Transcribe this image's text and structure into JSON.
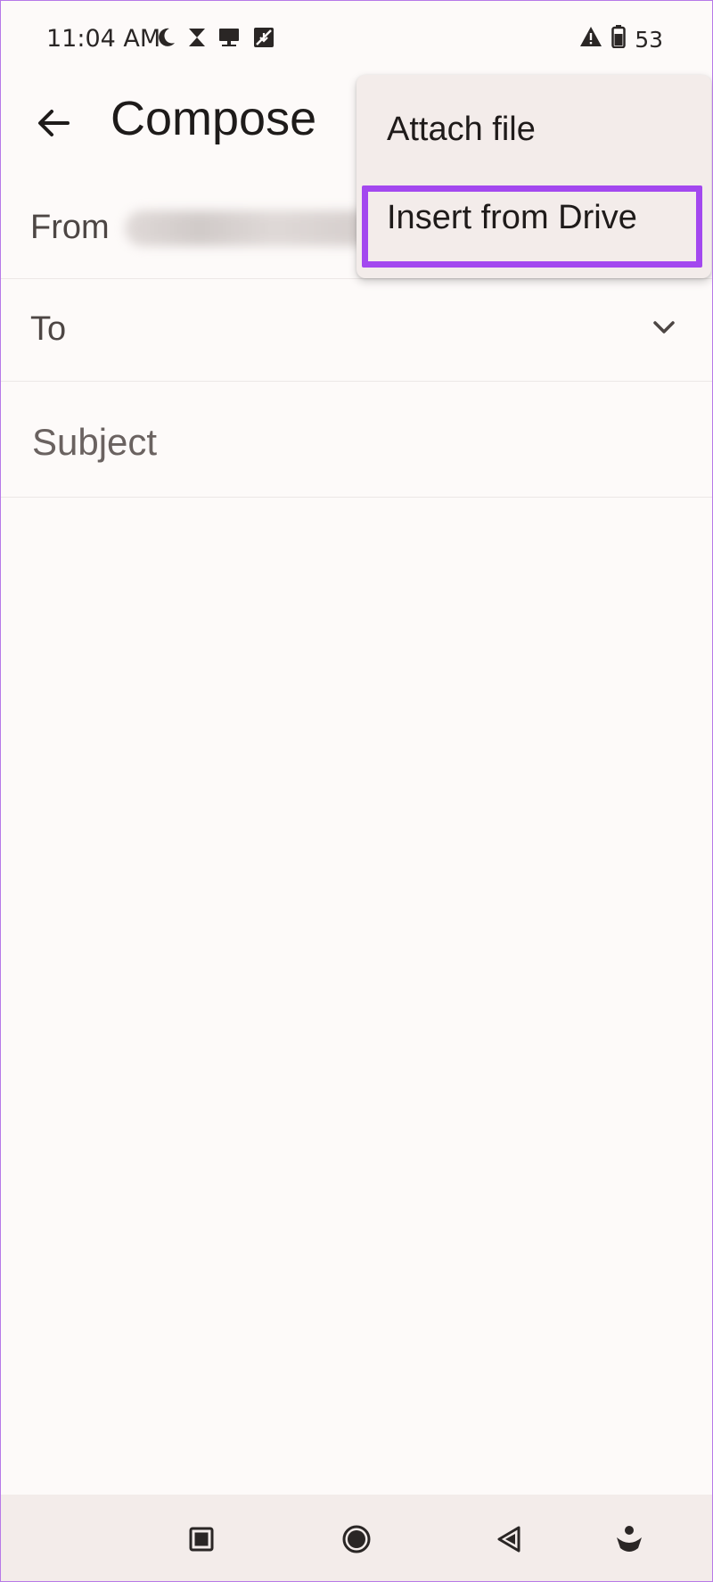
{
  "status_bar": {
    "time": "11:04 AM",
    "icons": [
      "moon-icon",
      "hourglass-icon",
      "cast-icon",
      "sync-disabled-icon"
    ],
    "alert_icon": "warning-icon",
    "battery_icon": "battery-icon",
    "battery_level": "53"
  },
  "app_bar": {
    "title": "Compose",
    "back_icon": "arrow-back-icon"
  },
  "compose": {
    "from_label": "From",
    "to_label": "To",
    "subject_placeholder": "Subject"
  },
  "overflow_menu": {
    "items": [
      {
        "label": "Attach file"
      },
      {
        "label": "Insert from Drive",
        "highlighted": true
      }
    ],
    "highlight_color": "#a348ef"
  },
  "nav_bar": {
    "buttons": [
      "recents-icon",
      "home-icon",
      "back-triangle-icon",
      "assistant-icon"
    ]
  }
}
